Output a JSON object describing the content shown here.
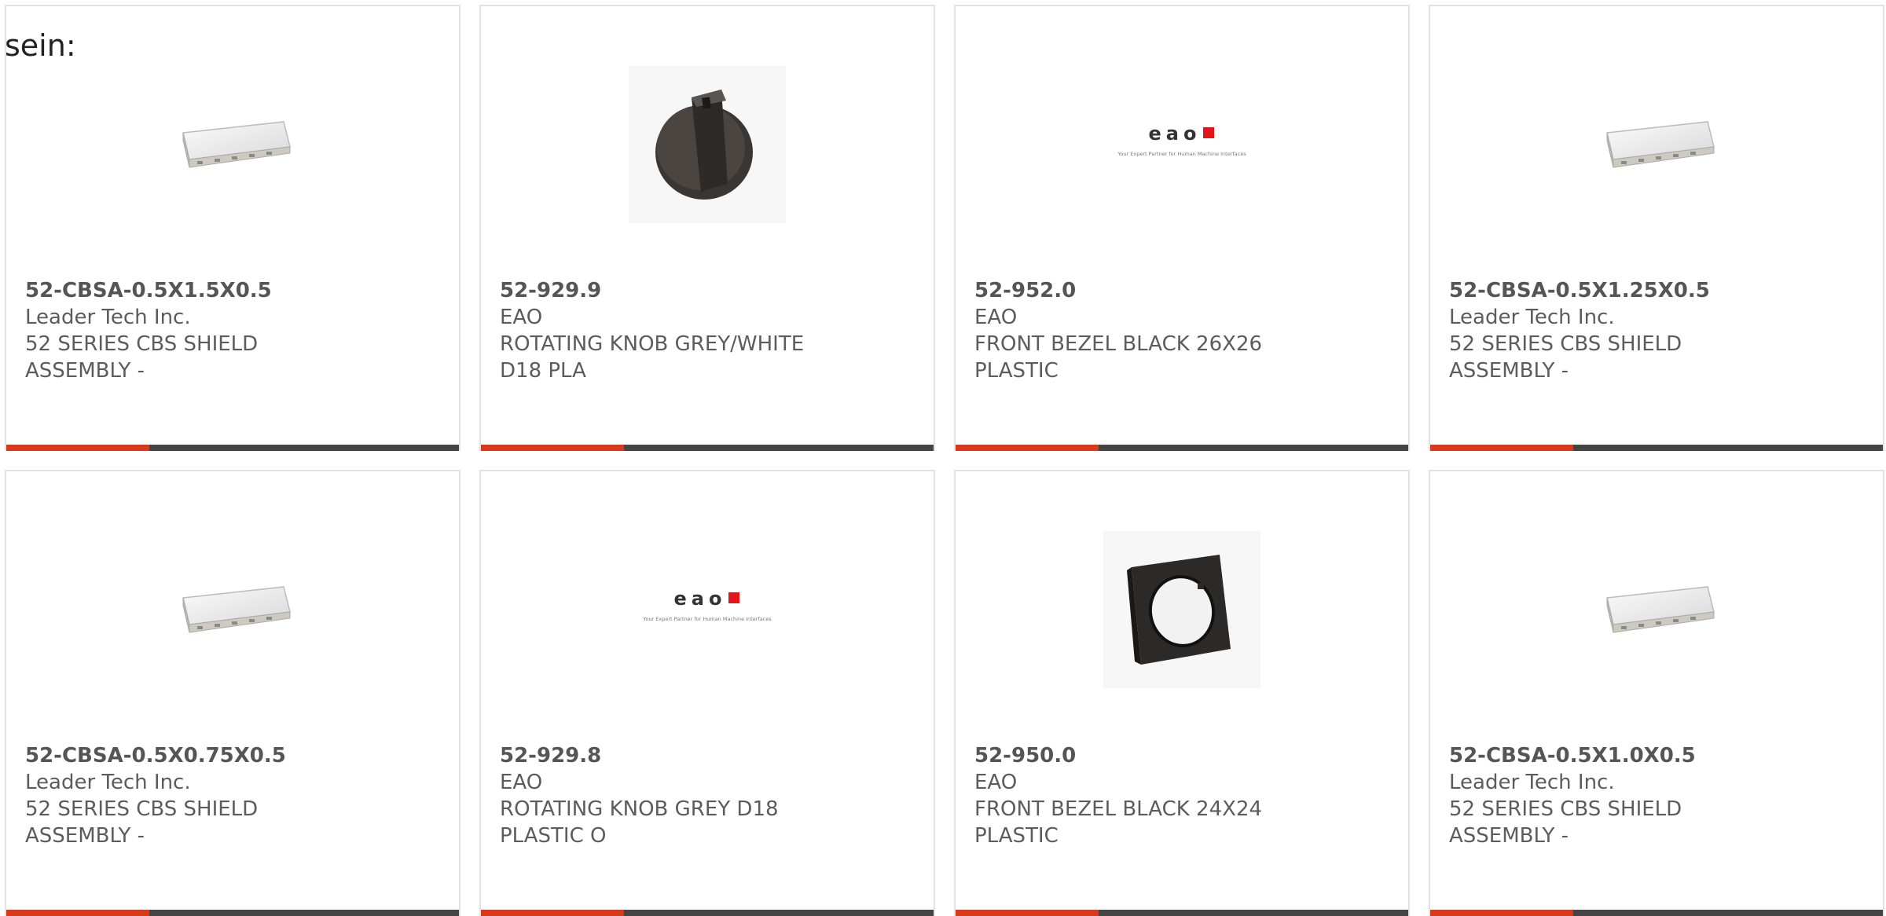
{
  "heading": "sein:",
  "colors": {
    "accent": "#d9391a",
    "bar": "#444444",
    "border": "#e2e2e2"
  },
  "products": [
    {
      "part": "52-CBSA-0.5X1.5X0.5",
      "maker": "Leader Tech Inc.",
      "desc1": "52 SERIES CBS SHIELD",
      "desc2": "ASSEMBLY -",
      "icon": "shield-image"
    },
    {
      "part": "52-929.9",
      "maker": "EAO",
      "desc1": "ROTATING KNOB GREY/WHITE",
      "desc2": "D18 PLA",
      "icon": "knob-image"
    },
    {
      "part": "52-952.0",
      "maker": "EAO",
      "desc1": "FRONT BEZEL BLACK 26X26",
      "desc2": "PLASTIC",
      "icon": "eao-logo-image"
    },
    {
      "part": "52-CBSA-0.5X1.25X0.5",
      "maker": "Leader Tech Inc.",
      "desc1": "52 SERIES CBS SHIELD",
      "desc2": "ASSEMBLY -",
      "icon": "shield-image"
    },
    {
      "part": "52-CBSA-0.5X0.75X0.5",
      "maker": "Leader Tech Inc.",
      "desc1": "52 SERIES CBS SHIELD",
      "desc2": "ASSEMBLY -",
      "icon": "shield-image"
    },
    {
      "part": "52-929.8",
      "maker": "EAO",
      "desc1": "ROTATING KNOB GREY D18",
      "desc2": "PLASTIC O",
      "icon": "eao-logo-image"
    },
    {
      "part": "52-950.0",
      "maker": "EAO",
      "desc1": "FRONT BEZEL BLACK 24X24",
      "desc2": "PLASTIC",
      "icon": "bezel-image"
    },
    {
      "part": "52-CBSA-0.5X1.0X0.5",
      "maker": "Leader Tech Inc.",
      "desc1": "52 SERIES CBS SHIELD",
      "desc2": "ASSEMBLY -",
      "icon": "shield-image"
    }
  ],
  "logo": {
    "text": "eao",
    "tagline": "Your Expert Partner for Human Machine Interfaces"
  }
}
